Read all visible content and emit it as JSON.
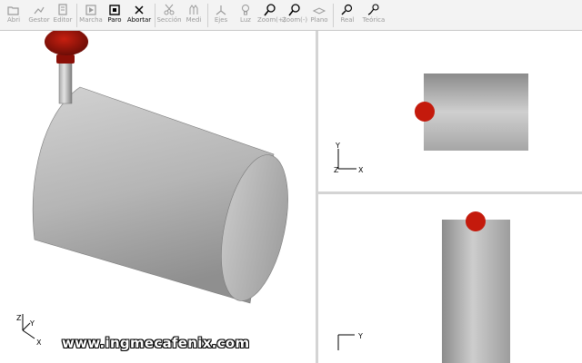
{
  "toolbar": {
    "buttons": [
      {
        "label": "Abri",
        "icon": "open-icon",
        "enabled": false
      },
      {
        "label": "Gestor",
        "icon": "manager-icon",
        "enabled": false
      },
      {
        "label": "Editor",
        "icon": "editor-icon",
        "enabled": false
      },
      {
        "label": "Marcha",
        "icon": "run-icon",
        "enabled": false
      },
      {
        "label": "Paro",
        "icon": "stop-icon",
        "enabled": true
      },
      {
        "label": "Abortar",
        "icon": "abort-icon",
        "enabled": true
      },
      {
        "label": "Sección",
        "icon": "section-icon",
        "enabled": false
      },
      {
        "label": "Medi",
        "icon": "measure-icon",
        "enabled": false
      },
      {
        "label": "Ejes",
        "icon": "axes-icon",
        "enabled": false
      },
      {
        "label": "Luz",
        "icon": "light-icon",
        "enabled": false
      },
      {
        "label": "Zoom(+)",
        "icon": "zoom-in-icon",
        "enabled": false
      },
      {
        "label": "Zoom(-)",
        "icon": "zoom-out-icon",
        "enabled": false
      },
      {
        "label": "Plano",
        "icon": "plane-icon",
        "enabled": false
      },
      {
        "label": "Real",
        "icon": "real-path-icon",
        "enabled": false
      },
      {
        "label": "Teórica",
        "icon": "theoretical-path-icon",
        "enabled": false
      }
    ]
  },
  "views": {
    "iso": {
      "axes": [
        "Z",
        "Y",
        "X"
      ]
    },
    "top": {
      "axes": [
        "Y",
        "Z",
        "X"
      ]
    },
    "front": {
      "axes": [
        "Y"
      ]
    }
  },
  "watermark": "www.ingmecafenix.com",
  "colors": {
    "tool": "#c41a0c",
    "stock": "#b5b5b5"
  }
}
